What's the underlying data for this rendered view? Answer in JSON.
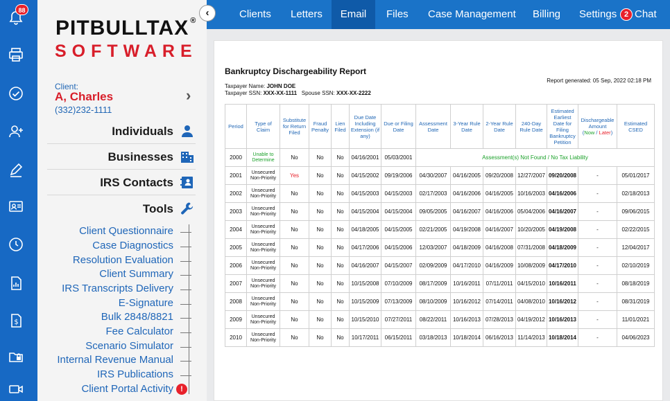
{
  "rail": {
    "bell_badge": "88"
  },
  "logo": {
    "line1": "PITBULLTAX",
    "reg": "®",
    "line2": "SOFTWARE"
  },
  "client": {
    "label": "Client:",
    "name": "A, Charles",
    "phone": "(332)232-1111"
  },
  "sections": [
    {
      "label": "Individuals",
      "icon": "person-icon"
    },
    {
      "label": "Businesses",
      "icon": "building-icon"
    },
    {
      "label": "IRS Contacts",
      "icon": "contacts-icon"
    },
    {
      "label": "Tools",
      "icon": "wrench-icon"
    }
  ],
  "tools": [
    "Client Questionnaire",
    "Case Diagnostics",
    "Resolution Evaluation",
    "Client Summary",
    "IRS Transcripts Delivery",
    "E-Signature",
    "Bulk 2848/8821",
    "Fee Calculator",
    "Scenario Simulator",
    "Internal Revenue Manual",
    "IRS Publications",
    "Client Portal Activity"
  ],
  "tools_alert": "!",
  "nav": {
    "items": [
      "Clients",
      "Letters",
      "Email",
      "Files",
      "Case Management",
      "Billing",
      "Settings"
    ],
    "active": "Email",
    "chat_badge": "2",
    "chat_label": "Chat"
  },
  "report": {
    "title": "Bankruptcy Dischargeability Report",
    "taxpayer_name_label": "Taxpayer Name:",
    "taxpayer_name": "JOHN DOE",
    "taxpayer_ssn_label": "Taxpayer SSN:",
    "taxpayer_ssn": "XXX-XX-1111",
    "spouse_ssn_label": "Spouse SSN:",
    "spouse_ssn": "XXX-XX-2222",
    "generated": "Report generated: 05 Sep, 2022 02:18 PM",
    "headers": [
      "Period",
      "Type of Claim",
      "Substitute for Return Filed",
      "Fraud Penalty",
      "Lien Filed",
      "Due Date Including Extension (if any)",
      "Due or Filing Date",
      "Assessment Date",
      "3-Year Rule Date",
      "2-Year Rule Date",
      "240-Day Rule Date",
      "Estimated Earliest Date for Filing Bankruptcy Petition",
      "Dischargeable Amount",
      "Estimated CSED"
    ],
    "dischargeable_now": "Now",
    "dischargeable_later": "Later",
    "row_2000": {
      "period": "2000",
      "type": "Unable to Determine",
      "sfr": "No",
      "fraud": "No",
      "lien": "No",
      "due_ext": "04/16/2001",
      "filing": "05/03/2001",
      "note": "Assessment(s) Not Found / No Tax Liability"
    },
    "rows": [
      [
        "2001",
        "Unsecured Non-Priority",
        "Yes",
        "No",
        "No",
        "04/15/2002",
        "09/19/2006",
        "04/30/2007",
        "04/16/2005",
        "09/20/2008",
        "12/27/2007",
        "09/20/2008",
        "-",
        "05/01/2017"
      ],
      [
        "2002",
        "Unsecured Non-Priority",
        "No",
        "No",
        "No",
        "04/15/2003",
        "04/15/2003",
        "02/17/2003",
        "04/16/2006",
        "04/16/2005",
        "10/16/2003",
        "04/16/2006",
        "-",
        "02/18/2013"
      ],
      [
        "2003",
        "Unsecured Non-Priority",
        "No",
        "No",
        "No",
        "04/15/2004",
        "04/15/2004",
        "09/05/2005",
        "04/16/2007",
        "04/16/2006",
        "05/04/2006",
        "04/16/2007",
        "-",
        "09/06/2015"
      ],
      [
        "2004",
        "Unsecured Non-Priority",
        "No",
        "No",
        "No",
        "04/18/2005",
        "04/15/2005",
        "02/21/2005",
        "04/19/2008",
        "04/16/2007",
        "10/20/2005",
        "04/19/2008",
        "-",
        "02/22/2015"
      ],
      [
        "2005",
        "Unsecured Non-Priority",
        "No",
        "No",
        "No",
        "04/17/2006",
        "04/15/2006",
        "12/03/2007",
        "04/18/2009",
        "04/16/2008",
        "07/31/2008",
        "04/18/2009",
        "-",
        "12/04/2017"
      ],
      [
        "2006",
        "Unsecured Non-Priority",
        "No",
        "No",
        "No",
        "04/16/2007",
        "04/15/2007",
        "02/09/2009",
        "04/17/2010",
        "04/16/2009",
        "10/08/2009",
        "04/17/2010",
        "-",
        "02/10/2019"
      ],
      [
        "2007",
        "Unsecured Non-Priority",
        "No",
        "No",
        "No",
        "10/15/2008",
        "07/10/2009",
        "08/17/2009",
        "10/16/2011",
        "07/11/2011",
        "04/15/2010",
        "10/16/2011",
        "-",
        "08/18/2019"
      ],
      [
        "2008",
        "Unsecured Non-Priority",
        "No",
        "No",
        "No",
        "10/15/2009",
        "07/13/2009",
        "08/10/2009",
        "10/16/2012",
        "07/14/2011",
        "04/08/2010",
        "10/16/2012",
        "-",
        "08/31/2019"
      ],
      [
        "2009",
        "Unsecured Non-Priority",
        "No",
        "No",
        "No",
        "10/15/2010",
        "07/27/2011",
        "08/22/2011",
        "10/16/2013",
        "07/28/2013",
        "04/19/2012",
        "10/16/2013",
        "-",
        "11/01/2021"
      ],
      [
        "2010",
        "Unsecured Non-Priority",
        "No",
        "No",
        "No",
        "10/17/2011",
        "06/15/2011",
        "03/18/2013",
        "10/18/2014",
        "06/16/2013",
        "11/14/2013",
        "10/18/2014",
        "-",
        "04/06/2023"
      ]
    ]
  },
  "colors": {
    "brand_blue": "#1a73c8",
    "active_tab": "#0f5aa8",
    "logo_red": "#d81e2a",
    "link_blue": "#1f66b8",
    "badge_red": "#e8212b",
    "green": "#1ba12a"
  }
}
